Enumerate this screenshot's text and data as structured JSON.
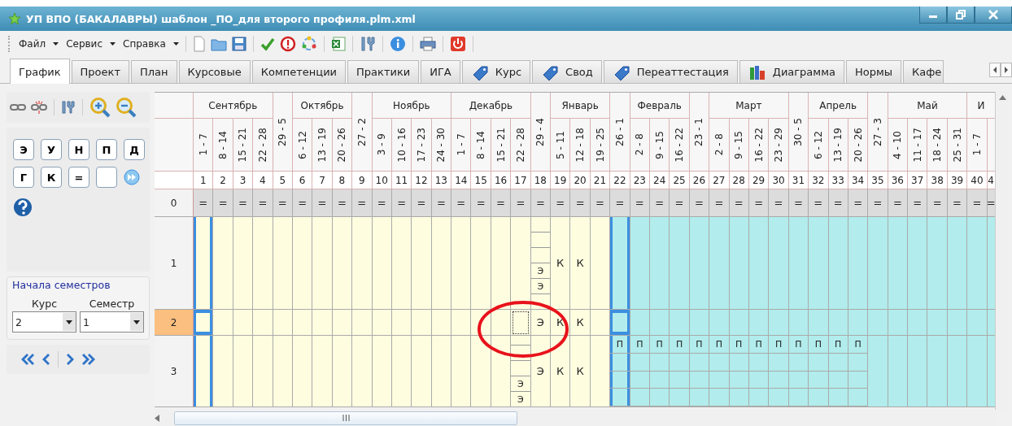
{
  "window": {
    "title": "УП ВПО (БАКАЛАВРЫ) шаблон _ПО_для второго профиля.plm.xml"
  },
  "menu": [
    "Файл",
    "Сервис",
    "Справка"
  ],
  "tabs": [
    {
      "label": "График",
      "kind": "plain",
      "selected": true
    },
    {
      "label": "Проект",
      "kind": "plain",
      "selected": false
    },
    {
      "label": "План",
      "kind": "plain",
      "selected": false
    },
    {
      "label": "Курсовые",
      "kind": "plain",
      "selected": false
    },
    {
      "label": "Компетенции",
      "kind": "plain",
      "selected": false
    },
    {
      "label": "Практики",
      "kind": "plain",
      "selected": false
    },
    {
      "label": "ИГА",
      "kind": "plain",
      "selected": false
    },
    {
      "label": "Курс",
      "kind": "tag",
      "selected": false
    },
    {
      "label": "Свод",
      "kind": "tag",
      "selected": false
    },
    {
      "label": "Переаттестация",
      "kind": "tag",
      "selected": false
    },
    {
      "label": "Диаграмма",
      "kind": "chart",
      "selected": false
    },
    {
      "label": "Нормы",
      "kind": "plain",
      "selected": false
    },
    {
      "label": "Кафе",
      "kind": "plain",
      "selected": false
    }
  ],
  "side_panel": {
    "letter_buttons": [
      "Э",
      "У",
      "Н",
      "П",
      "Д",
      "Г",
      "К",
      "="
    ],
    "semester_starts": {
      "title": "Начала семестров",
      "course": {
        "label": "Курс",
        "value": "2"
      },
      "semester": {
        "label": "Семестр",
        "value": "1"
      }
    }
  },
  "schedule": {
    "groups": [
      {
        "kind": "month",
        "name": "Сентябрь",
        "ranges": [
          "1 - 7",
          "8 - 14",
          "15 - 21",
          "22 - 28"
        ]
      },
      {
        "kind": "transition",
        "range": "29 - 5"
      },
      {
        "kind": "month",
        "name": "Октябрь",
        "ranges": [
          "6 - 12",
          "13 - 19",
          "20 - 26"
        ]
      },
      {
        "kind": "transition",
        "range": "27 - 2"
      },
      {
        "kind": "month",
        "name": "Ноябрь",
        "ranges": [
          "3 - 9",
          "10 - 16",
          "17 - 23",
          "24 - 30"
        ]
      },
      {
        "kind": "month",
        "name": "Декабрь",
        "ranges": [
          "1 - 7",
          "8 - 14",
          "15 - 21",
          "22 - 28"
        ]
      },
      {
        "kind": "transition",
        "range": "29 - 4"
      },
      {
        "kind": "month",
        "name": "Январь",
        "ranges": [
          "5 - 11",
          "12 - 18",
          "19 - 25"
        ]
      },
      {
        "kind": "transition",
        "range": "26 - 1"
      },
      {
        "kind": "month",
        "name": "Февраль",
        "ranges": [
          "2 - 8",
          "9 - 15",
          "16 - 22"
        ]
      },
      {
        "kind": "transition",
        "range": "23 - 1"
      },
      {
        "kind": "month",
        "name": "Март",
        "ranges": [
          "2 - 8",
          "9 - 15",
          "16 - 22",
          "23 - 29"
        ]
      },
      {
        "kind": "transition",
        "range": "30 - 5"
      },
      {
        "kind": "month",
        "name": "Апрель",
        "ranges": [
          "6 - 12",
          "13 - 19",
          "20 - 26"
        ]
      },
      {
        "kind": "transition",
        "range": "27 - 3"
      },
      {
        "kind": "month",
        "name": "Май",
        "ranges": [
          "4 - 10",
          "11 - 17",
          "18 - 24",
          "25 - 31"
        ]
      },
      {
        "kind": "month",
        "name": "И",
        "ranges": [
          "1 - 7"
        ]
      }
    ],
    "weeks": [
      {
        "number": "1",
        "semester_start": true
      },
      {
        "number": "2",
        "semester_start": false
      },
      {
        "number": "3",
        "semester_start": false
      },
      {
        "number": "4",
        "semester_start": false
      },
      {
        "number": "5",
        "semester_start": false
      },
      {
        "number": "6",
        "semester_start": false
      },
      {
        "number": "7",
        "semester_start": false
      },
      {
        "number": "8",
        "semester_start": false
      },
      {
        "number": "9",
        "semester_start": false
      },
      {
        "number": "10",
        "semester_start": false
      },
      {
        "number": "11",
        "semester_start": false
      },
      {
        "number": "12",
        "semester_start": false
      },
      {
        "number": "13",
        "semester_start": false
      },
      {
        "number": "14",
        "semester_start": false
      },
      {
        "number": "15",
        "semester_start": false
      },
      {
        "number": "16",
        "semester_start": false
      },
      {
        "number": "17",
        "semester_start": false
      },
      {
        "number": "18",
        "semester_start": false
      },
      {
        "number": "19",
        "semester_start": false
      },
      {
        "number": "20",
        "semester_start": false
      },
      {
        "number": "21",
        "semester_start": false
      },
      {
        "number": "22",
        "semester_start": true
      },
      {
        "number": "23",
        "semester_start": false
      },
      {
        "number": "24",
        "semester_start": false
      },
      {
        "number": "25",
        "semester_start": false
      },
      {
        "number": "26",
        "semester_start": false
      },
      {
        "number": "27",
        "semester_start": false
      },
      {
        "number": "28",
        "semester_start": false
      },
      {
        "number": "29",
        "semester_start": false
      },
      {
        "number": "30",
        "semester_start": false
      },
      {
        "number": "31",
        "semester_start": false
      },
      {
        "number": "32",
        "semester_start": false
      },
      {
        "number": "33",
        "semester_start": false
      },
      {
        "number": "34",
        "semester_start": false
      },
      {
        "number": "35",
        "semester_start": false
      },
      {
        "number": "36",
        "semester_start": false
      },
      {
        "number": "37",
        "semester_start": false
      },
      {
        "number": "38",
        "semester_start": false
      },
      {
        "number": "39",
        "semester_start": false
      },
      {
        "number": "40",
        "semester_start": false
      },
      {
        "number": "4",
        "semester_start": false
      }
    ],
    "rows": [
      {
        "label": "0",
        "selected": false,
        "kind": "summary",
        "cells": [
          "=",
          "=",
          "=",
          "=",
          "=",
          "=",
          "=",
          "=",
          "=",
          "=",
          "=",
          "=",
          "=",
          "=",
          "=",
          "=",
          "=",
          "=",
          "=",
          "=",
          "=",
          "=",
          "=",
          "=",
          "=",
          "=",
          "=",
          "=",
          "=",
          "=",
          "=",
          "=",
          "=",
          "=",
          "=",
          "=",
          "=",
          "=",
          "=",
          "=",
          "="
        ]
      },
      {
        "label": "1",
        "selected": false,
        "kind": "tall",
        "cells": [
          {
            "kind": "blank"
          },
          {
            "kind": "blank"
          },
          {
            "kind": "blank"
          },
          {
            "kind": "blank"
          },
          {
            "kind": "blank"
          },
          {
            "kind": "blank"
          },
          {
            "kind": "blank"
          },
          {
            "kind": "blank"
          },
          {
            "kind": "blank"
          },
          {
            "kind": "blank"
          },
          {
            "kind": "blank"
          },
          {
            "kind": "blank"
          },
          {
            "kind": "blank"
          },
          {
            "kind": "blank"
          },
          {
            "kind": "blank"
          },
          {
            "kind": "blank"
          },
          {
            "kind": "blank"
          },
          {
            "kind": "stack",
            "lines": [
              "Э",
              "Э"
            ]
          },
          {
            "kind": "text",
            "text": "К"
          },
          {
            "kind": "text",
            "text": "К"
          },
          {
            "kind": "blank"
          },
          {
            "kind": "blank"
          },
          {
            "kind": "blank"
          },
          {
            "kind": "blank"
          },
          {
            "kind": "blank"
          },
          {
            "kind": "blank"
          },
          {
            "kind": "blank"
          },
          {
            "kind": "blank"
          },
          {
            "kind": "blank"
          },
          {
            "kind": "blank"
          },
          {
            "kind": "blank"
          },
          {
            "kind": "blank"
          },
          {
            "kind": "blank"
          },
          {
            "kind": "blank"
          },
          {
            "kind": "blank"
          },
          {
            "kind": "blank"
          },
          {
            "kind": "blank"
          },
          {
            "kind": "blank"
          },
          {
            "kind": "blank"
          },
          {
            "kind": "blank"
          },
          {
            "kind": "blank"
          }
        ]
      },
      {
        "label": "2",
        "selected": true,
        "kind": "short",
        "cells": [
          {
            "kind": "blank"
          },
          {
            "kind": "blank"
          },
          {
            "kind": "blank"
          },
          {
            "kind": "blank"
          },
          {
            "kind": "blank"
          },
          {
            "kind": "blank"
          },
          {
            "kind": "blank"
          },
          {
            "kind": "blank"
          },
          {
            "kind": "blank"
          },
          {
            "kind": "blank"
          },
          {
            "kind": "blank"
          },
          {
            "kind": "blank"
          },
          {
            "kind": "blank"
          },
          {
            "kind": "blank"
          },
          {
            "kind": "blank"
          },
          {
            "kind": "blank"
          },
          {
            "kind": "focus"
          },
          {
            "kind": "text",
            "text": "Э"
          },
          {
            "kind": "text",
            "text": "К"
          },
          {
            "kind": "text",
            "text": "К"
          },
          {
            "kind": "blank"
          },
          {
            "kind": "blank"
          },
          {
            "kind": "blank"
          },
          {
            "kind": "blank"
          },
          {
            "kind": "blank"
          },
          {
            "kind": "blank"
          },
          {
            "kind": "blank"
          },
          {
            "kind": "blank"
          },
          {
            "kind": "blank"
          },
          {
            "kind": "blank"
          },
          {
            "kind": "blank"
          },
          {
            "kind": "blank"
          },
          {
            "kind": "blank"
          },
          {
            "kind": "blank"
          },
          {
            "kind": "blank"
          },
          {
            "kind": "blank"
          },
          {
            "kind": "blank"
          },
          {
            "kind": "blank"
          },
          {
            "kind": "blank"
          },
          {
            "kind": "blank"
          },
          {
            "kind": "blank"
          }
        ]
      },
      {
        "label": "3",
        "selected": false,
        "kind": "partial",
        "cells": [
          {
            "kind": "blank"
          },
          {
            "kind": "blank"
          },
          {
            "kind": "blank"
          },
          {
            "kind": "blank"
          },
          {
            "kind": "blank"
          },
          {
            "kind": "blank"
          },
          {
            "kind": "blank"
          },
          {
            "kind": "blank"
          },
          {
            "kind": "blank"
          },
          {
            "kind": "blank"
          },
          {
            "kind": "blank"
          },
          {
            "kind": "blank"
          },
          {
            "kind": "blank"
          },
          {
            "kind": "blank"
          },
          {
            "kind": "blank"
          },
          {
            "kind": "blank"
          },
          {
            "kind": "stack",
            "lines": [
              "Э",
              "Э"
            ]
          },
          {
            "kind": "text",
            "text": "Э"
          },
          {
            "kind": "text",
            "text": "К"
          },
          {
            "kind": "text",
            "text": "К"
          },
          {
            "kind": "blank"
          },
          {
            "kind": "top",
            "text": "П"
          },
          {
            "kind": "top",
            "text": "П"
          },
          {
            "kind": "top",
            "text": "П"
          },
          {
            "kind": "top",
            "text": "П"
          },
          {
            "kind": "top",
            "text": "П"
          },
          {
            "kind": "top",
            "text": "П"
          },
          {
            "kind": "top",
            "text": "П"
          },
          {
            "kind": "top",
            "text": "П"
          },
          {
            "kind": "top",
            "text": "П"
          },
          {
            "kind": "top",
            "text": "П"
          },
          {
            "kind": "top",
            "text": "П"
          },
          {
            "kind": "top",
            "text": "П"
          },
          {
            "kind": "top",
            "text": "П"
          },
          {
            "kind": "blank"
          },
          {
            "kind": "blank"
          },
          {
            "kind": "blank"
          },
          {
            "kind": "blank"
          },
          {
            "kind": "blank"
          },
          {
            "kind": "blank"
          },
          {
            "kind": "blank"
          }
        ]
      }
    ]
  }
}
